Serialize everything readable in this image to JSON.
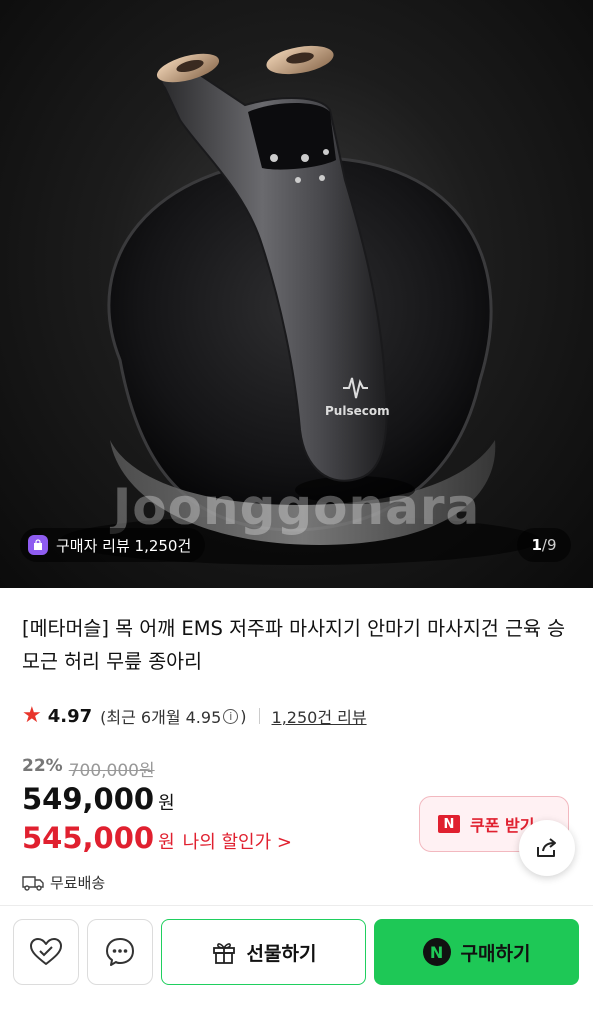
{
  "hero": {
    "watermark": "Joonggonara",
    "brand_mark": "Pulsecom",
    "review_chip": "구매자 리뷰 1,250건",
    "page_current": "1",
    "page_total": "9",
    "page_sep": "/"
  },
  "product": {
    "title": "[메타머슬] 목 어깨 EMS 저주파 마사지기 안마기 마사지건 근육 승모근 허리 무릎 종아리",
    "rating": "4.97",
    "recent_label": "(최근 6개월 4.95",
    "recent_close": ")",
    "reviews_link": "1,250건 리뷰",
    "discount_pct": "22%",
    "original_price": "700,000원",
    "price": "549,000",
    "price_unit": "원",
    "sale_price": "545,000",
    "sale_unit": "원",
    "my_price_label": "나의 할인가 >",
    "shipping": "무료배송"
  },
  "actions": {
    "coupon_label": "쿠폰 받기",
    "gift_label": "선물하기",
    "buy_label": "구매하기"
  },
  "colors": {
    "sale_red": "#e0202f",
    "naver_green": "#1ec856",
    "star": "#e8352b"
  }
}
